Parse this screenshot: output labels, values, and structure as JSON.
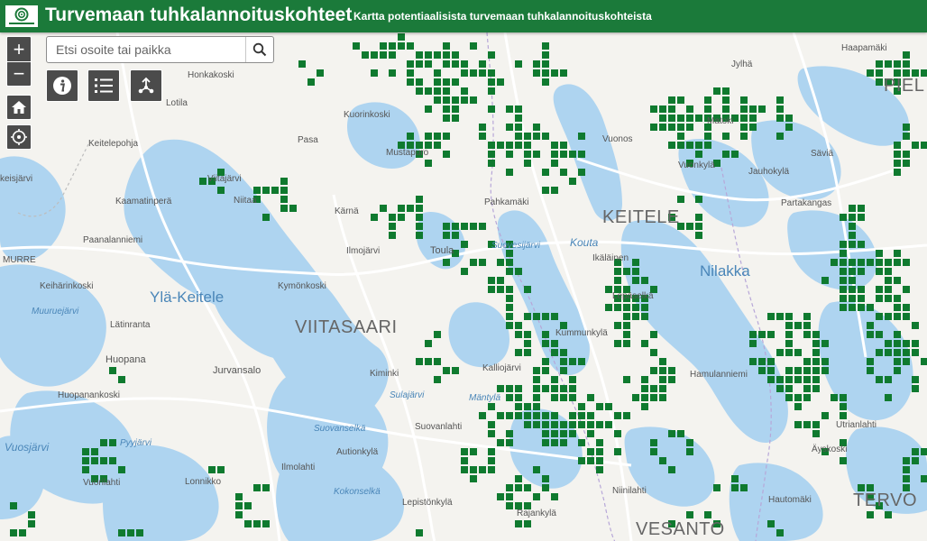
{
  "header": {
    "title": "Turvemaan tuhkalannoituskohteet",
    "subtitle": "Kartta potentiaalisista turvemaan tuhkalannoituskohteista",
    "logo_icon": "luke-logo-icon",
    "background": "#1b7a3a"
  },
  "search": {
    "placeholder": "Etsi osoite tai paikka",
    "value": ""
  },
  "toolbar": {
    "zoom_in_symbol": "+",
    "zoom_out_symbol": "−",
    "home_icon": "home-icon",
    "locate_icon": "locate-icon",
    "info_icon": "info-icon",
    "legend_icon": "legend-icon",
    "share_icon": "share-icon"
  },
  "map": {
    "colors": {
      "site": "#0f7a2f",
      "water": "#aed4f0",
      "land": "#f4f3ef",
      "road": "#ffffff"
    },
    "places": [
      {
        "id": "viitasaari",
        "text": "VIITASAARI"
      },
      {
        "id": "keitele",
        "text": "KEITELE"
      },
      {
        "id": "tervo",
        "text": "TERVO"
      },
      {
        "id": "piel",
        "text": "PIEL"
      },
      {
        "id": "vesanto",
        "text": "VESANTO"
      },
      {
        "id": "yla-keitele",
        "text": "Ylä-Keitele"
      },
      {
        "id": "nilakka",
        "text": "Nilakka"
      },
      {
        "id": "vuosjarvi",
        "text": "Vuosjärvi"
      },
      {
        "id": "koutajarvi",
        "text": "Kouta"
      },
      {
        "id": "honkakoski",
        "text": "Honkakoski"
      },
      {
        "id": "lotila",
        "text": "Lotila"
      },
      {
        "id": "keitelepohja",
        "text": "Keitelepohja"
      },
      {
        "id": "keisjarvi",
        "text": "keisjärvi"
      },
      {
        "id": "viitajarvi",
        "text": "Viitajärvi"
      },
      {
        "id": "kaamatinpera",
        "text": "Kaamatinperä"
      },
      {
        "id": "niittaa",
        "text": "Niitaa"
      },
      {
        "id": "paanalanniemi",
        "text": "Paanalanniemi"
      },
      {
        "id": "murre",
        "text": "MURRE"
      },
      {
        "id": "keiharinkoski",
        "text": "Keihärinkoski"
      },
      {
        "id": "muuruejarvi",
        "text": "Muuruejärvi"
      },
      {
        "id": "latinranta",
        "text": "Lätinranta"
      },
      {
        "id": "huopana",
        "text": "Huopana"
      },
      {
        "id": "jurvansalo",
        "text": "Jurvansalo"
      },
      {
        "id": "huopanankoski",
        "text": "Huopanankoski"
      },
      {
        "id": "pyyjarvi",
        "text": "Pyyjärvi"
      },
      {
        "id": "vuorilahti",
        "text": "Vuorilahti"
      },
      {
        "id": "lonnikko",
        "text": "Lonnikko"
      },
      {
        "id": "kuorinkoski",
        "text": "Kuorinkoski"
      },
      {
        "id": "mustapuro",
        "text": "Mustapuro"
      },
      {
        "id": "pasa",
        "text": "Pasa"
      },
      {
        "id": "karna",
        "text": "Kärnä"
      },
      {
        "id": "ilmojarvi",
        "text": "Ilmojärvi"
      },
      {
        "id": "toula",
        "text": "Toula"
      },
      {
        "id": "kymonkoski",
        "text": "Kymönkoski"
      },
      {
        "id": "kiminki",
        "text": "Kiminki"
      },
      {
        "id": "sulajarvi",
        "text": "Sulajärvi"
      },
      {
        "id": "suovanselka",
        "text": "Suovanselkä"
      },
      {
        "id": "autionkyla",
        "text": "Autionkylä"
      },
      {
        "id": "ilmolahti",
        "text": "Ilmolahti"
      },
      {
        "id": "kokonselka",
        "text": "Kokonselkä"
      },
      {
        "id": "suovanlahti",
        "text": "Suovanlahti"
      },
      {
        "id": "lepistonkyla",
        "text": "Lepistönkylä"
      },
      {
        "id": "rajankyla",
        "text": "Rajankylä"
      },
      {
        "id": "pahkamaki",
        "text": "Pahkamäki"
      },
      {
        "id": "suovesijarvi",
        "text": "Suovesijärvi"
      },
      {
        "id": "ikalainen",
        "text": "Ikäläinen"
      },
      {
        "id": "lepaselka",
        "text": "Lepäselkä"
      },
      {
        "id": "kummunkyla",
        "text": "Kummunkylä"
      },
      {
        "id": "kalliojarvi",
        "text": "Kalliojärvi"
      },
      {
        "id": "mantyla",
        "text": "Mäntylä"
      },
      {
        "id": "hamulanniemi",
        "text": "Hamulanniemi"
      },
      {
        "id": "niinilahti",
        "text": "Niinilahti"
      },
      {
        "id": "haapamaki",
        "text": "Haapamäki"
      },
      {
        "id": "jylha",
        "text": "Jylhä"
      },
      {
        "id": "matoki",
        "text": "Matoki"
      },
      {
        "id": "vuonos",
        "text": "Vuonos"
      },
      {
        "id": "vuonkyla",
        "text": "Vuonkylä"
      },
      {
        "id": "jauhokyla",
        "text": "Jauhokylä"
      },
      {
        "id": "savia",
        "text": "Säviä"
      },
      {
        "id": "partakangas",
        "text": "Partakangas"
      },
      {
        "id": "utrianlahti",
        "text": "Utrianlahti"
      },
      {
        "id": "ayskoski",
        "text": "Äyskoski"
      },
      {
        "id": "hautomaki",
        "text": "Hautomäki"
      }
    ]
  }
}
